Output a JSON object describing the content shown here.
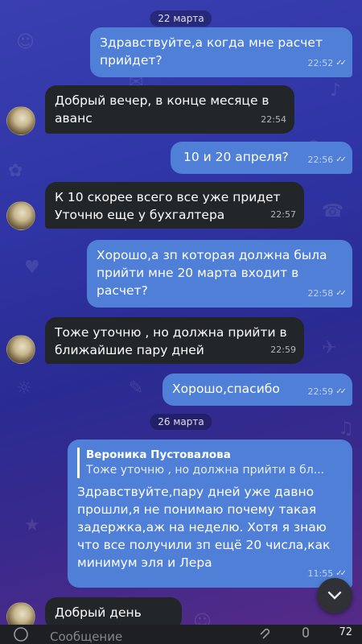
{
  "dates": {
    "first": "22 марта",
    "second": "26 марта"
  },
  "messages": [
    {
      "dir": "out",
      "text": "Здравствуйте,а когда мне расчет\nприйдет?",
      "time": "22:52"
    },
    {
      "dir": "in",
      "text": "Добрый вечер, в конце месяце в\nаванс",
      "time": "22:54"
    },
    {
      "dir": "out",
      "text": "10 и 20 апреля?",
      "time": "22:56"
    },
    {
      "dir": "in",
      "text": "К 10 скорее всего все уже придет\nУточню еще у бухгалтера",
      "time": "22:57"
    },
    {
      "dir": "out",
      "text": "Хорошо,а зп которая должна была\nприйти мне 20 марта входит в\nрасчет?",
      "time": "22:58"
    },
    {
      "dir": "in",
      "text": "Тоже уточню , но должна прийти в\nближайшие пару дней",
      "time": "22:59"
    },
    {
      "dir": "out",
      "text": "Хорошо,спасибо",
      "time": "22:59"
    },
    {
      "dir": "out",
      "reply_name": "Вероника Пустовалова",
      "reply_text": "Тоже уточню , но должна прийти в бл...",
      "text": "Здравствуйте,пару дней уже давно\nпрошли,я не понимаю почему такая\nзадержка,аж на неделю. Хотя я знаю\nчто все получили зп ещё 20 числа,как\nминимум эля и Лера",
      "time": "11:55"
    },
    {
      "dir": "in",
      "text": "Добрый день",
      "time": ""
    }
  ],
  "input": {
    "placeholder": "Сообщение",
    "counter": "72"
  },
  "icons": {
    "scroll_down": "chevron-down-icon",
    "emoji": "emoji-icon",
    "attach": "paperclip-icon",
    "mic": "microphone-icon",
    "read": "double-check-icon"
  }
}
